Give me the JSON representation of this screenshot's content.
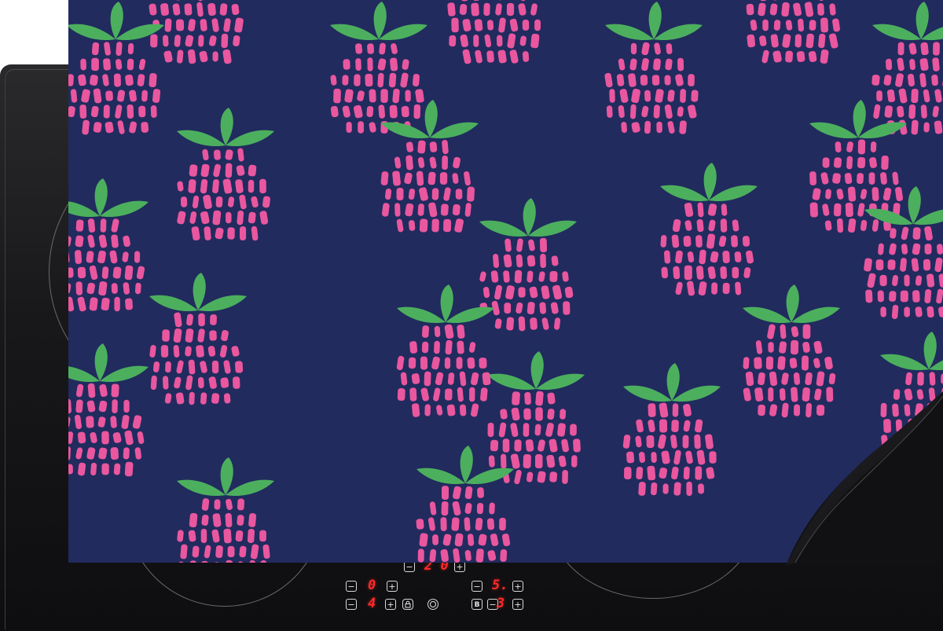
{
  "scene": {
    "subject": "induction-hob-protector-mat",
    "mat": {
      "background_color": "#212b5e",
      "berry_color": "#e9579f",
      "leaf_color": "#4caf5e",
      "pattern": "raspberry"
    },
    "hob": {
      "glass_color": "#151517",
      "display_color": "#ff2a2a",
      "controls": [
        {
          "minus": "−",
          "value": "2 0",
          "plus": "+"
        },
        {
          "minus": "−",
          "value": "0",
          "plus": "+"
        },
        {
          "minus": "−",
          "value": "5.",
          "plus": "+"
        },
        {
          "minus": "−",
          "value": "4",
          "plus": "+",
          "extra_icon": "lock-icon"
        },
        {
          "minus": "B",
          "value": "3",
          "plus": "+",
          "extra_icon": "timer-icon"
        }
      ]
    }
  }
}
